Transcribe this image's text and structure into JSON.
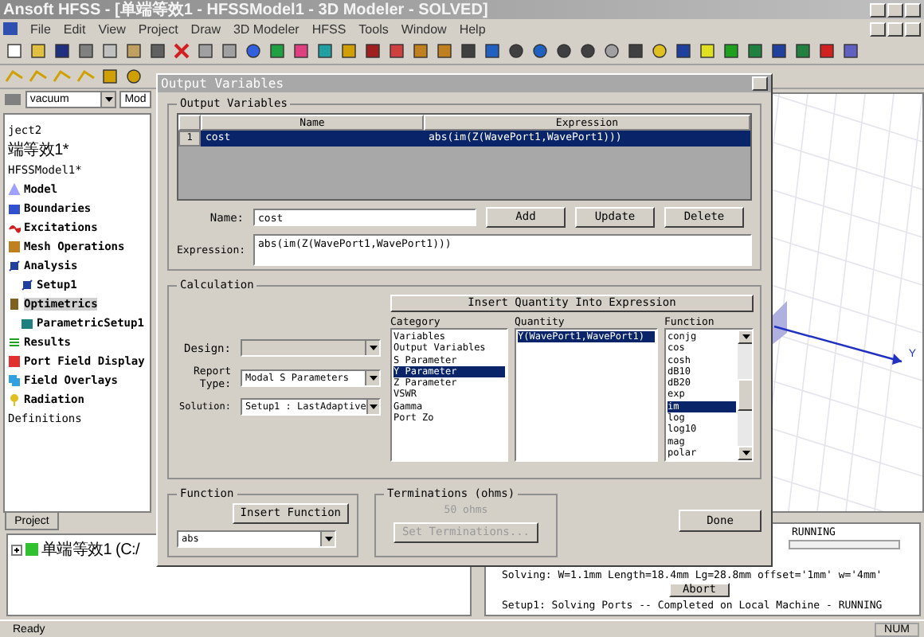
{
  "window": {
    "title": "Ansoft HFSS - [单端等效1 - HFSSModel1 - 3D Modeler - SOLVED]"
  },
  "menu": [
    "File",
    "Edit",
    "View",
    "Project",
    "Draw",
    "3D Modeler",
    "HFSS",
    "Tools",
    "Window",
    "Help"
  ],
  "material_combo": {
    "value": "vacuum"
  },
  "model_combo": {
    "value": "Mod"
  },
  "project_tree": [
    {
      "label": "ject2",
      "kind": "text"
    },
    {
      "label": "端等效1*",
      "kind": "text"
    },
    {
      "label": "HFSSModel1*",
      "kind": "text"
    },
    {
      "label": "Model",
      "kind": "model"
    },
    {
      "label": "Boundaries",
      "kind": "boundaries"
    },
    {
      "label": "Excitations",
      "kind": "excitations"
    },
    {
      "label": "Mesh Operations",
      "kind": "mesh"
    },
    {
      "label": "Analysis",
      "kind": "analysis",
      "children": [
        {
          "label": "Setup1",
          "kind": "analysis"
        }
      ]
    },
    {
      "label": "Optimetrics",
      "kind": "optimetrics",
      "selected": true,
      "children": [
        {
          "label": "ParametricSetup1",
          "kind": "parametric"
        }
      ]
    },
    {
      "label": "Results",
      "kind": "results"
    },
    {
      "label": "Port Field Display",
      "kind": "port"
    },
    {
      "label": "Field Overlays",
      "kind": "overlays"
    },
    {
      "label": "Radiation",
      "kind": "radiation"
    },
    {
      "label": "Definitions",
      "kind": "text"
    }
  ],
  "project_tab": {
    "label": "Project",
    "selected": true
  },
  "bottom_tree": [
    {
      "label": "单端等效1 (C:/",
      "expanded": false
    }
  ],
  "view": {
    "axis_label": "Y"
  },
  "messages": {
    "status": "RUNNING",
    "solving": "Solving: W=1.1mm Length=18.4mm Lg=28.8mm offset='1mm' w='4mm'",
    "abort_button": "Abort",
    "result": "Setup1: Solving Ports -- Completed on Local Machine - RUNNING"
  },
  "status_bar": {
    "left": "Ready",
    "num": "NUM"
  },
  "dialog": {
    "title": "Output Variables",
    "output_group": {
      "title": "Output Variables",
      "columns": [
        "Name",
        "Expression"
      ],
      "rows": [
        {
          "index": "1",
          "name": "cost",
          "expression": "abs(im(Z(WavePort1,WavePort1)))",
          "selected": true
        }
      ]
    },
    "name_field": {
      "label": "Name:",
      "value": "cost"
    },
    "buttons": [
      "Add",
      "Update",
      "Delete"
    ],
    "expression_field": {
      "label": "Expression:",
      "value": "abs(im(Z(WavePort1,WavePort1)))"
    },
    "calculation": {
      "title": "Calculation",
      "insert_button": "Insert Quantity Into Expression",
      "design": {
        "label": "Design:",
        "disabled": true
      },
      "report_type": {
        "label": "Report Type:",
        "value": "Modal S Parameters"
      },
      "solution": {
        "label": "Solution:",
        "value": "Setup1 : LastAdaptive"
      },
      "category": {
        "label": "Category",
        "items": [
          {
            "label": "Variables",
            "selected": false
          },
          {
            "label": "Output Variables",
            "selected": false
          },
          {
            "label": "S Parameter",
            "selected": false
          },
          {
            "label": "Y Parameter",
            "selected": true
          },
          {
            "label": "Z Parameter",
            "selected": false
          },
          {
            "label": "VSWR",
            "selected": false
          },
          {
            "label": "Gamma",
            "selected": false
          },
          {
            "label": "Port Zo",
            "selected": false
          }
        ]
      },
      "quantity": {
        "label": "Quantity",
        "items": [
          {
            "label": "Y(WavePort1,WavePort1)",
            "selected": true
          }
        ]
      },
      "function": {
        "label": "Function",
        "items": [
          {
            "label": "conjg",
            "selected": false
          },
          {
            "label": "cos",
            "selected": false
          },
          {
            "label": "cosh",
            "selected": false
          },
          {
            "label": "dB10",
            "selected": false
          },
          {
            "label": "dB20",
            "selected": false
          },
          {
            "label": "exp",
            "selected": false
          },
          {
            "label": "im",
            "selected": true
          },
          {
            "label": "log",
            "selected": false
          },
          {
            "label": "log10",
            "selected": false
          },
          {
            "label": "mag",
            "selected": false
          },
          {
            "label": "polar",
            "selected": false
          }
        ]
      }
    },
    "function_group": {
      "title": "Function",
      "insert_button": "Insert Function",
      "value": "abs"
    },
    "terminations": {
      "title": "Terminations (ohms)",
      "value": "50 ohms",
      "button": "Set Terminations...",
      "disabled": true
    },
    "done_button": "Done"
  }
}
